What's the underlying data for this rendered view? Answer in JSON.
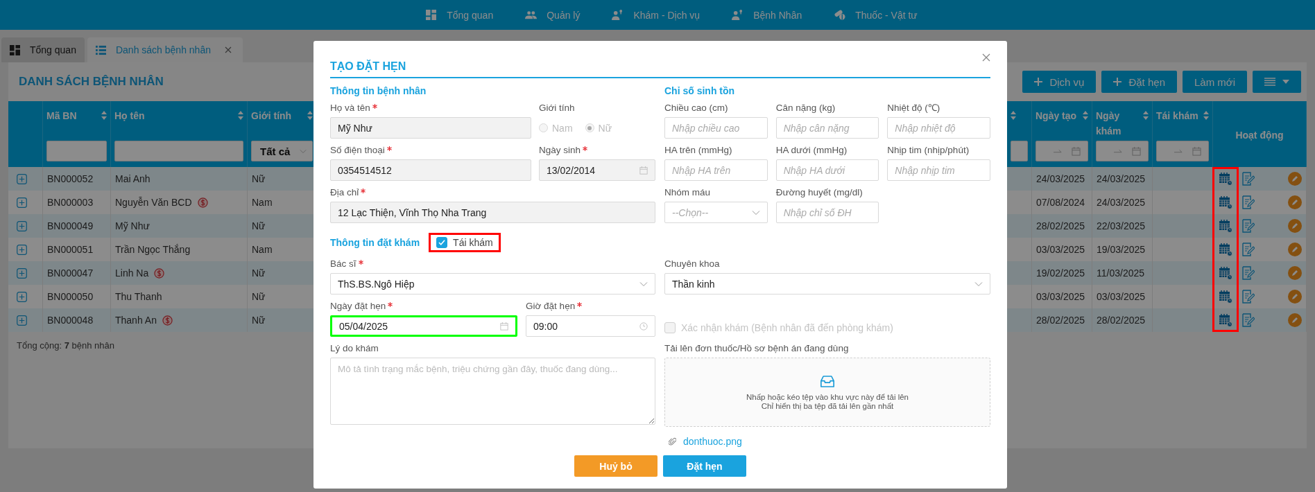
{
  "nav": [
    {
      "label": "Tổng quan"
    },
    {
      "label": "Quản lý"
    },
    {
      "label": "Khám - Dịch vụ"
    },
    {
      "label": "Bệnh Nhân"
    },
    {
      "label": "Thuốc - Vật tư"
    }
  ],
  "tabs": [
    {
      "label": "Tổng quan",
      "selected": false
    },
    {
      "label": "Danh sách bệnh nhân",
      "selected": true
    }
  ],
  "panel": {
    "title": "DANH SÁCH BỆNH NHÂN",
    "buttons": [
      {
        "kind": "add",
        "label": "Dịch vụ"
      },
      {
        "kind": "add",
        "label": "Đặt hẹn"
      },
      {
        "kind": "plain",
        "label": "Làm mới"
      },
      {
        "kind": "columns"
      }
    ],
    "footer": "Tổng cộng: **7** bệnh nhân"
  },
  "table": {
    "columns": [
      {
        "label": "Mã BN",
        "kind": "text_filter"
      },
      {
        "label": "Họ tên",
        "kind": "text_filter"
      },
      {
        "label": "Giới tính",
        "kind": "select_filter",
        "filter_value": "Tất cả"
      },
      {
        "kind": "text_filter"
      },
      {
        "label": "Ngày tạo",
        "kind": "date_filter"
      },
      {
        "label": "Ngày khám",
        "kind": "date_filter"
      },
      {
        "label": "Tái khám",
        "kind": "date_filter"
      },
      {
        "label": "Hoạt động",
        "kind": "actions"
      }
    ],
    "schedule_highlighted": true,
    "rows": [
      {
        "code": "BN000052",
        "name": "Mai Anh",
        "debt": false,
        "gender": "Nữ",
        "created": "24/03/2025",
        "exam_date": "24/03/2025"
      },
      {
        "code": "BN000003",
        "name": "Nguyễn Văn BCD",
        "debt": true,
        "gender": "Nam",
        "created": "07/08/2024",
        "exam_date": "24/03/2025"
      },
      {
        "code": "BN000049",
        "name": "Mỹ Như",
        "debt": false,
        "gender": "Nữ",
        "created": "28/02/2025",
        "exam_date": "22/03/2025"
      },
      {
        "code": "BN000051",
        "name": "Trần Ngọc Thắng",
        "debt": false,
        "gender": "Nam",
        "created": "03/03/2025",
        "exam_date": "19/03/2025"
      },
      {
        "code": "BN000047",
        "name": "Linh Na",
        "debt": true,
        "gender": "Nữ",
        "created": "19/02/2025",
        "exam_date": "11/03/2025"
      },
      {
        "code": "BN000050",
        "name": "Thu Thanh",
        "debt": false,
        "gender": "Nữ",
        "created": "03/03/2025",
        "exam_date": "03/03/2025"
      },
      {
        "code": "BN000048",
        "name": "Thanh An",
        "debt": true,
        "gender": "Nữ",
        "created": "28/02/2025",
        "exam_date": "28/02/2025"
      }
    ]
  },
  "modal": {
    "title": "TẠO ĐẶT HẸN",
    "patient_section": "Thông tin bệnh nhân",
    "vitals_section": "Chỉ số sinh tồn",
    "full_name": {
      "label": "Họ và tên",
      "required": true,
      "value": "Mỹ Như"
    },
    "gender": {
      "label": "Giới tính",
      "disabled": true,
      "options": [
        {
          "label": "Nam",
          "selected": false
        },
        {
          "label": "Nữ",
          "selected": true
        }
      ]
    },
    "phone": {
      "label": "Số điện thoại",
      "required": true,
      "value": "0354514512"
    },
    "birth_date": {
      "label": "Ngày sinh",
      "required": true,
      "value": "13/02/2014"
    },
    "address": {
      "label": "Địa chỉ",
      "required": true,
      "value": "12 Lạc Thiện, Vĩnh Thọ Nha Trang"
    },
    "vitals": [
      {
        "kind": "input",
        "label": "Chiều cao (cm)",
        "placeholder": "Nhập chiều cao"
      },
      {
        "kind": "input",
        "label": "Cân nặng (kg)",
        "placeholder": "Nhập cân nặng"
      },
      {
        "kind": "input",
        "label": "Nhiệt độ (℃)",
        "placeholder": "Nhập nhiệt độ"
      },
      {
        "kind": "input",
        "label": "HA trên (mmHg)",
        "placeholder": "Nhập HA trên"
      },
      {
        "kind": "input",
        "label": "HA dưới (mmHg)",
        "placeholder": "Nhập HA dưới"
      },
      {
        "kind": "input",
        "label": "Nhịp tim (nhịp/phút)",
        "placeholder": "Nhập nhịp tim"
      },
      {
        "kind": "select",
        "label": "Nhóm máu",
        "placeholder": "--Chọn--"
      },
      {
        "kind": "input",
        "label": "Đường huyết (mg/dl)",
        "placeholder": "Nhập chỉ số ĐH"
      }
    ],
    "booking_section": "Thông tin đặt khám",
    "recheck": {
      "label": "Tái khám",
      "checked": true,
      "highlighted": true
    },
    "doctor": {
      "label": "Bác sĩ",
      "required": true,
      "value": "ThS.BS.Ngô Hiệp"
    },
    "specialty": {
      "label": "Chuyên khoa",
      "required": false,
      "value": "Thần kinh"
    },
    "appointment_date": {
      "label": "Ngày đặt hẹn",
      "required": true,
      "value": "05/04/2025",
      "highlighted": true
    },
    "appointment_time": {
      "label": "Giờ đặt hẹn",
      "required": true,
      "value": "09:00"
    },
    "confirm": {
      "label": "Xác nhận khám (Bệnh nhân đã đến phòng khám)",
      "checked": false,
      "disabled": true
    },
    "reason": {
      "label": "Lý do khám",
      "placeholder": "Mô tả tình trạng mắc bệnh, triệu chứng gần đây, thuốc đang dùng..."
    },
    "upload": {
      "label": "Tải lên đơn thuốc/Hồ sơ bệnh án đang dùng",
      "hint": "Nhấp hoặc kéo tệp vào khu vực này để tải lên",
      "note": "Chỉ hiển thị ba tệp đã tải lên gần nhất",
      "files": [
        "donthuoc.png"
      ]
    },
    "buttons": [
      {
        "kind": "cancel",
        "label": "Huỷ bỏ"
      },
      {
        "kind": "primary",
        "label": "Đặt hẹn"
      }
    ]
  }
}
